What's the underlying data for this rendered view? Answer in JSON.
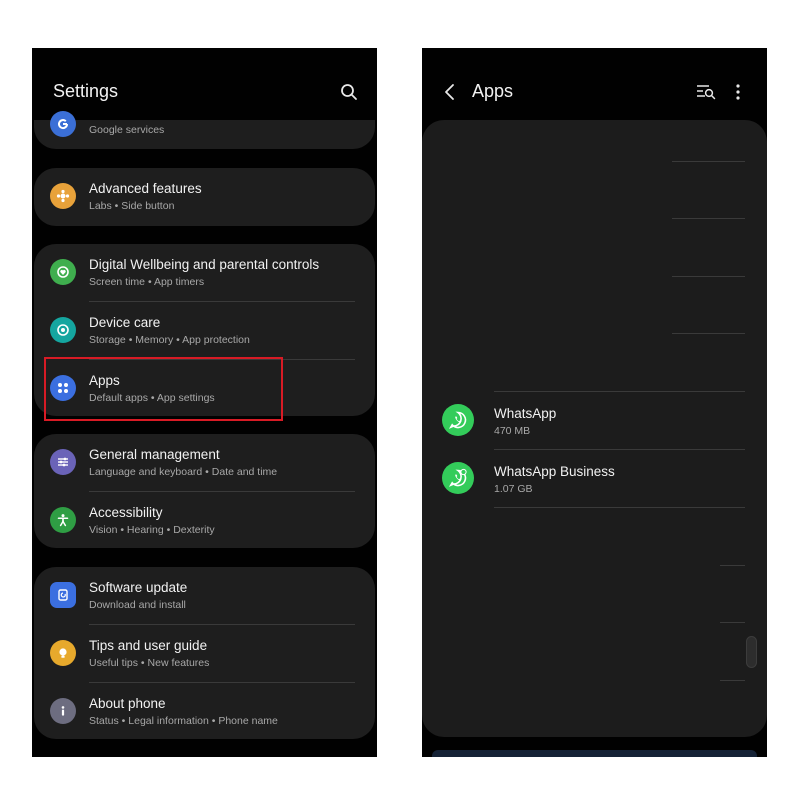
{
  "left": {
    "title": "Settings",
    "items": [
      {
        "title": "",
        "sub": "Google services",
        "icon": "google-icon",
        "color": "#3b6fd6"
      },
      {
        "title": "Advanced features",
        "sub": "Labs  •  Side button",
        "icon": "advanced-features-icon",
        "color": "#e8a23a"
      },
      {
        "title": "Digital Wellbeing and parental controls",
        "sub": "Screen time  •  App timers",
        "icon": "wellbeing-icon",
        "color": "#3fae4e"
      },
      {
        "title": "Device care",
        "sub": "Storage  •  Memory  •  App protection",
        "icon": "device-care-icon",
        "color": "#15a6a0"
      },
      {
        "title": "Apps",
        "sub": "Default apps  •  App settings",
        "icon": "apps-icon",
        "color": "#3b6fe0"
      },
      {
        "title": "General management",
        "sub": "Language and keyboard  •  Date and time",
        "icon": "general-management-icon",
        "color": "#6a63b8"
      },
      {
        "title": "Accessibility",
        "sub": "Vision  •  Hearing  •  Dexterity",
        "icon": "accessibility-icon",
        "color": "#2f9e44"
      },
      {
        "title": "Software update",
        "sub": "Download and install",
        "icon": "software-update-icon",
        "color": "#3b6fe0"
      },
      {
        "title": "Tips and user guide",
        "sub": "Useful tips  •  New features",
        "icon": "tips-icon",
        "color": "#e7a92c"
      },
      {
        "title": "About phone",
        "sub": "Status  •  Legal information  •  Phone name",
        "icon": "about-phone-icon",
        "color": "#6d6d80"
      }
    ]
  },
  "right": {
    "title": "Apps",
    "apps": [
      {
        "name": "WhatsApp",
        "size": "470 MB",
        "icon": "whatsapp-icon"
      },
      {
        "name": "WhatsApp Business",
        "size": "1.07 GB",
        "icon": "whatsapp-business-icon"
      }
    ]
  },
  "colors": {
    "highlight": "#d81b25",
    "whatsapp": "#33cc5a"
  }
}
